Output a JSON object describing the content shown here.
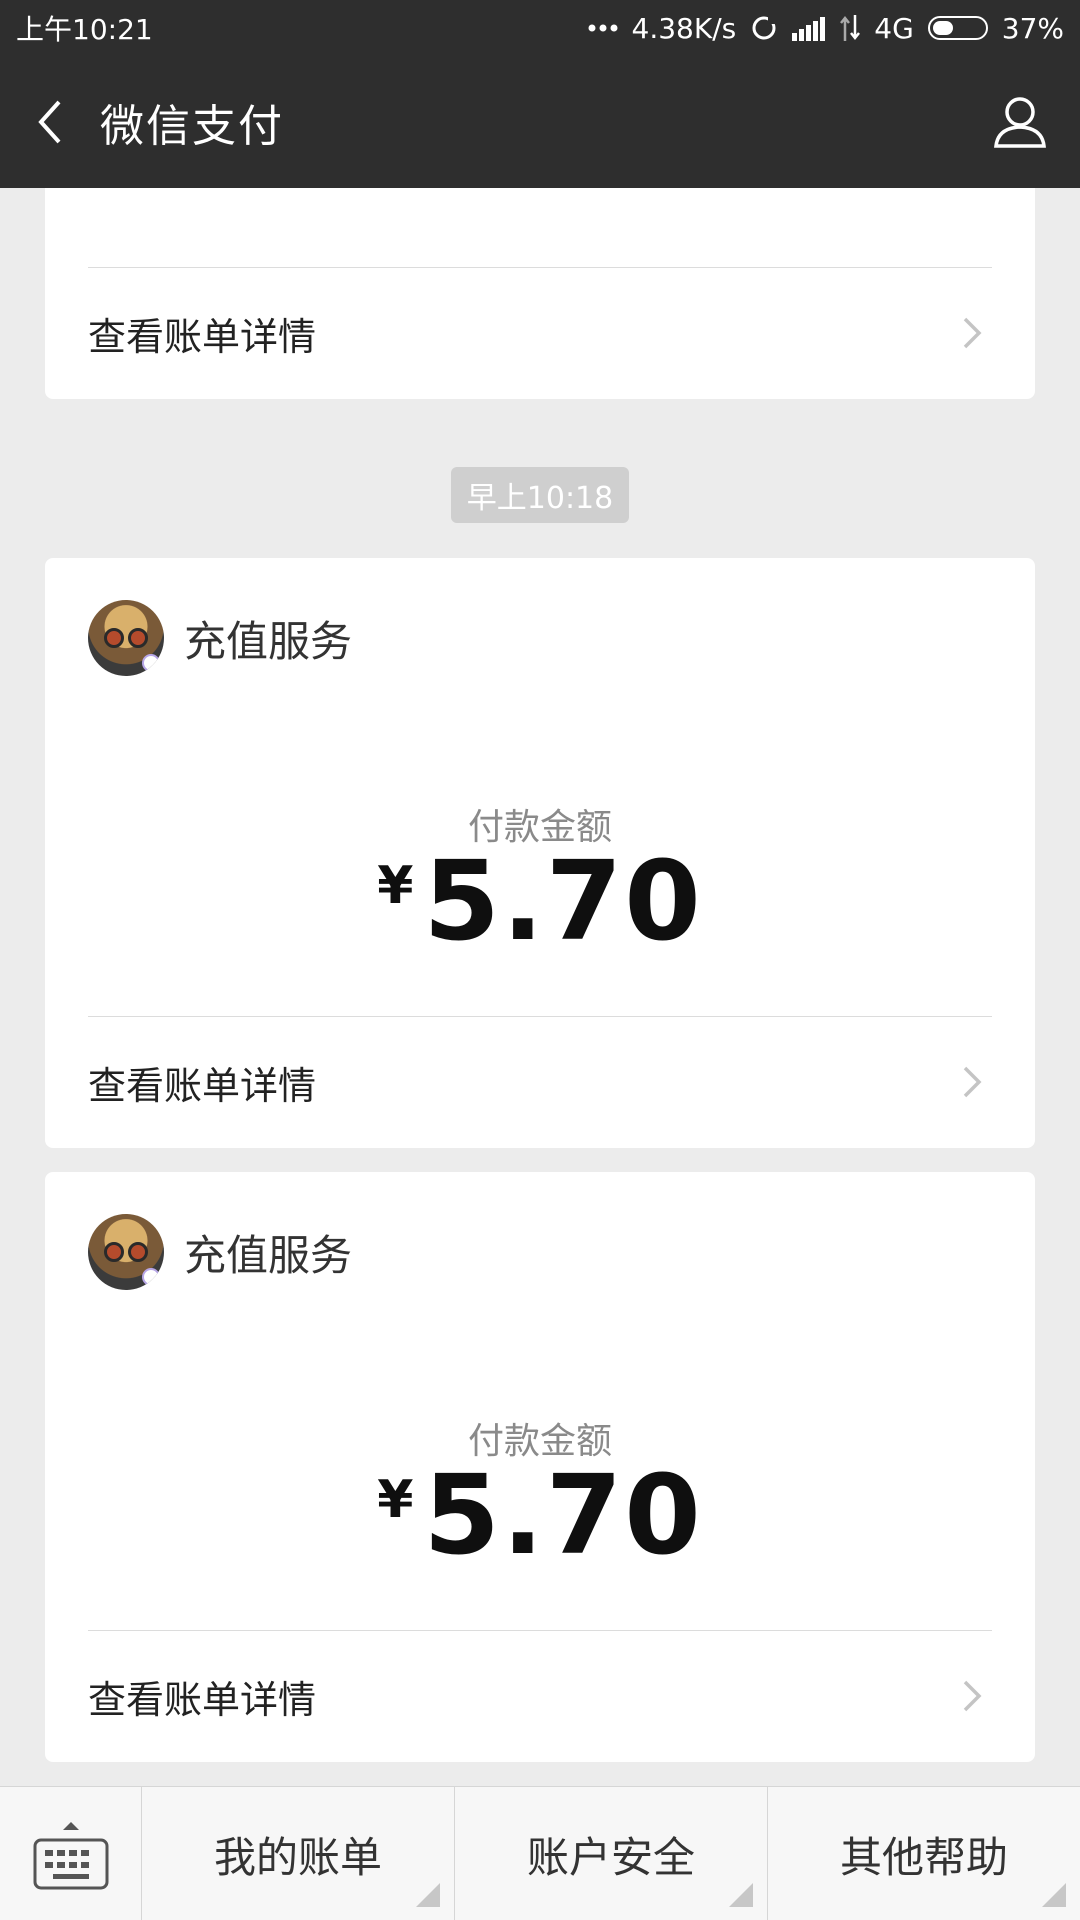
{
  "status_bar": {
    "time": "上午10:21",
    "net_speed": "4.38K/s",
    "network": "4G",
    "battery": "37%",
    "battery_level": 0.37
  },
  "nav": {
    "title": "微信支付"
  },
  "messages": {
    "top_detail_label": "查看账单详情",
    "timestamp": "早上10:18",
    "payments": [
      {
        "merchant": "充值服务",
        "pay_label": "付款金额",
        "currency": "¥",
        "amount": "5.70",
        "detail_label": "查看账单详情"
      },
      {
        "merchant": "充值服务",
        "pay_label": "付款金额",
        "currency": "¥",
        "amount": "5.70",
        "detail_label": "查看账单详情"
      }
    ]
  },
  "bottom_menu": {
    "items": [
      "我的账单",
      "账户安全",
      "其他帮助"
    ]
  },
  "colors": {
    "header_bg": "#2e2e2e",
    "page_bg": "#ececec",
    "card_bg": "#ffffff",
    "timestamp_bg": "#cfcfcf"
  }
}
